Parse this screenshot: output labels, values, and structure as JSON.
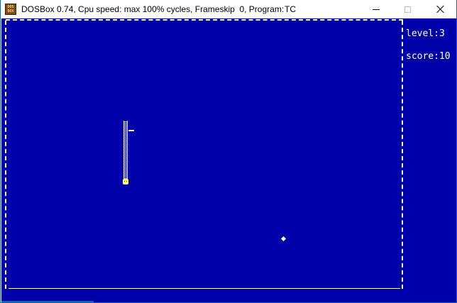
{
  "window": {
    "title": "DOSBox 0.74, Cpu speed: max 100% cycles, Frameskip  0, Program:",
    "program": "TC",
    "icon_text": "DOS BOX",
    "controls": {
      "minimize_icon": "minimize-icon",
      "maximize_icon": "maximize-icon",
      "close_icon": "close-icon"
    }
  },
  "game": {
    "background_color": "#0000aa",
    "border_color": "#ffffff",
    "level_text": "level:3",
    "score_text": "score:10",
    "snake_color": "#ffff66",
    "food_color": "#ffffff"
  }
}
